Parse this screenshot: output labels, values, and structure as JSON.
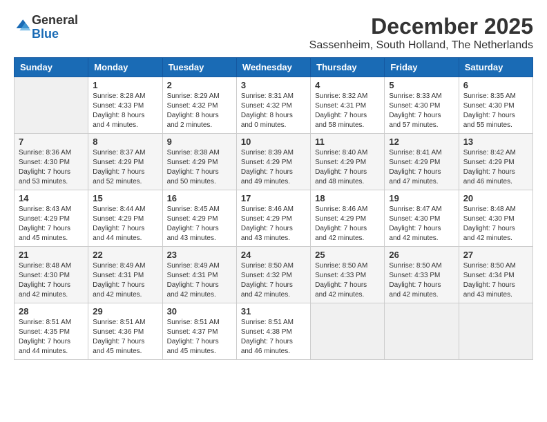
{
  "header": {
    "logo_general": "General",
    "logo_blue": "Blue",
    "month_title": "December 2025",
    "location": "Sassenheim, South Holland, The Netherlands"
  },
  "calendar": {
    "days_of_week": [
      "Sunday",
      "Monday",
      "Tuesday",
      "Wednesday",
      "Thursday",
      "Friday",
      "Saturday"
    ],
    "weeks": [
      [
        {
          "day": "",
          "sunrise": "",
          "sunset": "",
          "daylight": ""
        },
        {
          "day": "1",
          "sunrise": "Sunrise: 8:28 AM",
          "sunset": "Sunset: 4:33 PM",
          "daylight": "Daylight: 8 hours and 4 minutes."
        },
        {
          "day": "2",
          "sunrise": "Sunrise: 8:29 AM",
          "sunset": "Sunset: 4:32 PM",
          "daylight": "Daylight: 8 hours and 2 minutes."
        },
        {
          "day": "3",
          "sunrise": "Sunrise: 8:31 AM",
          "sunset": "Sunset: 4:32 PM",
          "daylight": "Daylight: 8 hours and 0 minutes."
        },
        {
          "day": "4",
          "sunrise": "Sunrise: 8:32 AM",
          "sunset": "Sunset: 4:31 PM",
          "daylight": "Daylight: 7 hours and 58 minutes."
        },
        {
          "day": "5",
          "sunrise": "Sunrise: 8:33 AM",
          "sunset": "Sunset: 4:30 PM",
          "daylight": "Daylight: 7 hours and 57 minutes."
        },
        {
          "day": "6",
          "sunrise": "Sunrise: 8:35 AM",
          "sunset": "Sunset: 4:30 PM",
          "daylight": "Daylight: 7 hours and 55 minutes."
        }
      ],
      [
        {
          "day": "7",
          "sunrise": "Sunrise: 8:36 AM",
          "sunset": "Sunset: 4:30 PM",
          "daylight": "Daylight: 7 hours and 53 minutes."
        },
        {
          "day": "8",
          "sunrise": "Sunrise: 8:37 AM",
          "sunset": "Sunset: 4:29 PM",
          "daylight": "Daylight: 7 hours and 52 minutes."
        },
        {
          "day": "9",
          "sunrise": "Sunrise: 8:38 AM",
          "sunset": "Sunset: 4:29 PM",
          "daylight": "Daylight: 7 hours and 50 minutes."
        },
        {
          "day": "10",
          "sunrise": "Sunrise: 8:39 AM",
          "sunset": "Sunset: 4:29 PM",
          "daylight": "Daylight: 7 hours and 49 minutes."
        },
        {
          "day": "11",
          "sunrise": "Sunrise: 8:40 AM",
          "sunset": "Sunset: 4:29 PM",
          "daylight": "Daylight: 7 hours and 48 minutes."
        },
        {
          "day": "12",
          "sunrise": "Sunrise: 8:41 AM",
          "sunset": "Sunset: 4:29 PM",
          "daylight": "Daylight: 7 hours and 47 minutes."
        },
        {
          "day": "13",
          "sunrise": "Sunrise: 8:42 AM",
          "sunset": "Sunset: 4:29 PM",
          "daylight": "Daylight: 7 hours and 46 minutes."
        }
      ],
      [
        {
          "day": "14",
          "sunrise": "Sunrise: 8:43 AM",
          "sunset": "Sunset: 4:29 PM",
          "daylight": "Daylight: 7 hours and 45 minutes."
        },
        {
          "day": "15",
          "sunrise": "Sunrise: 8:44 AM",
          "sunset": "Sunset: 4:29 PM",
          "daylight": "Daylight: 7 hours and 44 minutes."
        },
        {
          "day": "16",
          "sunrise": "Sunrise: 8:45 AM",
          "sunset": "Sunset: 4:29 PM",
          "daylight": "Daylight: 7 hours and 43 minutes."
        },
        {
          "day": "17",
          "sunrise": "Sunrise: 8:46 AM",
          "sunset": "Sunset: 4:29 PM",
          "daylight": "Daylight: 7 hours and 43 minutes."
        },
        {
          "day": "18",
          "sunrise": "Sunrise: 8:46 AM",
          "sunset": "Sunset: 4:29 PM",
          "daylight": "Daylight: 7 hours and 42 minutes."
        },
        {
          "day": "19",
          "sunrise": "Sunrise: 8:47 AM",
          "sunset": "Sunset: 4:30 PM",
          "daylight": "Daylight: 7 hours and 42 minutes."
        },
        {
          "day": "20",
          "sunrise": "Sunrise: 8:48 AM",
          "sunset": "Sunset: 4:30 PM",
          "daylight": "Daylight: 7 hours and 42 minutes."
        }
      ],
      [
        {
          "day": "21",
          "sunrise": "Sunrise: 8:48 AM",
          "sunset": "Sunset: 4:30 PM",
          "daylight": "Daylight: 7 hours and 42 minutes."
        },
        {
          "day": "22",
          "sunrise": "Sunrise: 8:49 AM",
          "sunset": "Sunset: 4:31 PM",
          "daylight": "Daylight: 7 hours and 42 minutes."
        },
        {
          "day": "23",
          "sunrise": "Sunrise: 8:49 AM",
          "sunset": "Sunset: 4:31 PM",
          "daylight": "Daylight: 7 hours and 42 minutes."
        },
        {
          "day": "24",
          "sunrise": "Sunrise: 8:50 AM",
          "sunset": "Sunset: 4:32 PM",
          "daylight": "Daylight: 7 hours and 42 minutes."
        },
        {
          "day": "25",
          "sunrise": "Sunrise: 8:50 AM",
          "sunset": "Sunset: 4:33 PM",
          "daylight": "Daylight: 7 hours and 42 minutes."
        },
        {
          "day": "26",
          "sunrise": "Sunrise: 8:50 AM",
          "sunset": "Sunset: 4:33 PM",
          "daylight": "Daylight: 7 hours and 42 minutes."
        },
        {
          "day": "27",
          "sunrise": "Sunrise: 8:50 AM",
          "sunset": "Sunset: 4:34 PM",
          "daylight": "Daylight: 7 hours and 43 minutes."
        }
      ],
      [
        {
          "day": "28",
          "sunrise": "Sunrise: 8:51 AM",
          "sunset": "Sunset: 4:35 PM",
          "daylight": "Daylight: 7 hours and 44 minutes."
        },
        {
          "day": "29",
          "sunrise": "Sunrise: 8:51 AM",
          "sunset": "Sunset: 4:36 PM",
          "daylight": "Daylight: 7 hours and 45 minutes."
        },
        {
          "day": "30",
          "sunrise": "Sunrise: 8:51 AM",
          "sunset": "Sunset: 4:37 PM",
          "daylight": "Daylight: 7 hours and 45 minutes."
        },
        {
          "day": "31",
          "sunrise": "Sunrise: 8:51 AM",
          "sunset": "Sunset: 4:38 PM",
          "daylight": "Daylight: 7 hours and 46 minutes."
        },
        {
          "day": "",
          "sunrise": "",
          "sunset": "",
          "daylight": ""
        },
        {
          "day": "",
          "sunrise": "",
          "sunset": "",
          "daylight": ""
        },
        {
          "day": "",
          "sunrise": "",
          "sunset": "",
          "daylight": ""
        }
      ]
    ]
  }
}
